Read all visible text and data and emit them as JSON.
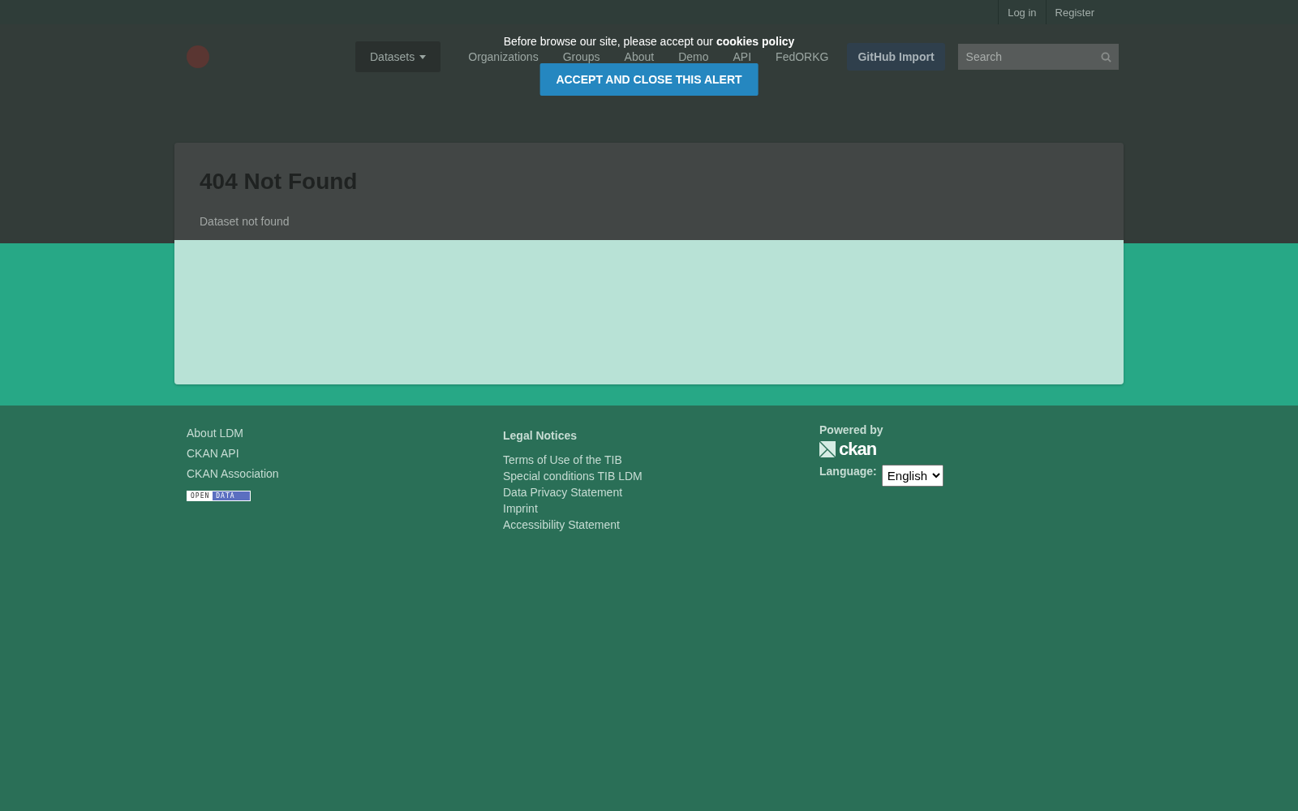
{
  "account_links": [
    {
      "label": "Log in"
    },
    {
      "label": "Register"
    }
  ],
  "nav": {
    "items": [
      {
        "label": "Datasets",
        "selected": true,
        "kind": "dropdown"
      },
      {
        "label": "Organizations",
        "selected": false,
        "kind": "link"
      },
      {
        "label": "Groups",
        "selected": false,
        "kind": "link"
      },
      {
        "label": "About",
        "selected": false,
        "kind": "link"
      },
      {
        "label": "Demo",
        "selected": false,
        "kind": "link"
      },
      {
        "label": "API",
        "selected": false,
        "kind": "link"
      },
      {
        "label": "FedORKG",
        "selected": false,
        "kind": "link"
      },
      {
        "label": "GitHub Import",
        "selected": false,
        "kind": "button"
      }
    ],
    "search": {
      "placeholder": "Search"
    }
  },
  "error": {
    "title": "404 Not Found",
    "message": "Dataset not found"
  },
  "footer": {
    "links": [
      "About LDM",
      "CKAN API",
      "CKAN Association"
    ],
    "badge": {
      "left": "OPEN",
      "right": "DATA"
    },
    "legal": {
      "title": "Legal Notices",
      "links": [
        "Terms of Use of the TIB",
        "Special conditions TIB LDM",
        "Data Privacy Statement",
        "Imprint",
        "Accessibility Statement"
      ]
    },
    "powered_by": "Powered by",
    "ckan": "ckan",
    "language_label": "Language:",
    "language": "English"
  },
  "cookie_alert": {
    "text": "Before browse our site, please accept our **cookies policy**",
    "button": "ACCEPT AND CLOSE THIS ALERT"
  }
}
